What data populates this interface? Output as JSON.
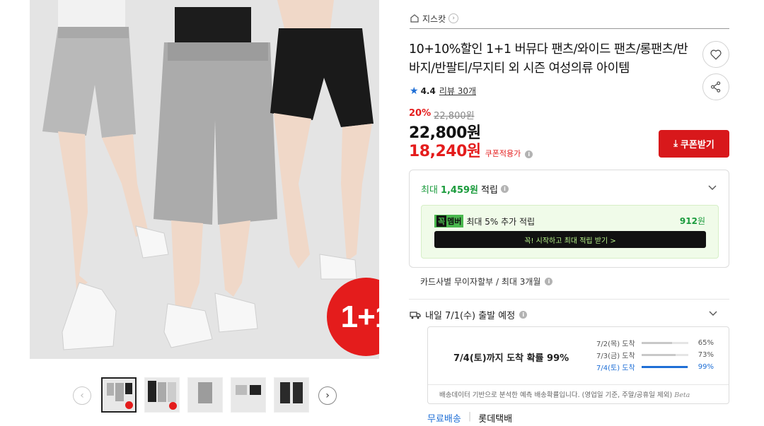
{
  "store": {
    "name": "지스캇"
  },
  "product": {
    "title": "10+10%할인 1+1 버뮤다 팬츠/와이드 팬츠/롱팬츠/반바지/반팔티/무지티 외 시즌 여성의류 아이템",
    "badge": "1+1",
    "rating": "4.4",
    "review_label": "리뷰 30개"
  },
  "price": {
    "discount_pct": "20%",
    "original": "22,800원",
    "price": "22,800원",
    "coupon_price": "18,240원",
    "coupon_label": "쿠폰적용가"
  },
  "buttons": {
    "coupon": "쿠폰받기"
  },
  "points": {
    "prefix": "최대",
    "amount": "1,459원",
    "suffix": "적립",
    "member_logo_k": "꼭",
    "member_logo": "멤버",
    "member_text": "최대 5% 추가 적립",
    "member_amount": "912",
    "member_unit": "원",
    "member_cta": "꼭! 시작하고 최대 적립 받기 >"
  },
  "installment": "카드사별 무이자할부 / 최대 3개월",
  "delivery": {
    "label": "내일 7/1(수) 출발 예정",
    "probability_headline": "7/4(토)까지 도착 확률 99%",
    "items": [
      {
        "date": "7/2(목) 도착",
        "pct": "65%",
        "value": 0.65
      },
      {
        "date": "7/3(금) 도착",
        "pct": "73%",
        "value": 0.73
      },
      {
        "date": "7/4(토) 도착",
        "pct": "99%",
        "value": 0.99
      }
    ],
    "note": "배송데이터 기반으로 분석한 예측 배송확률입니다. (영업일 기준, 주말/공휴일 제외)",
    "beta": "Beta"
  },
  "shipping": {
    "free": "무료배송",
    "carrier": "롯데택배"
  },
  "icons": {
    "store": "store-icon",
    "heart": "heart-icon",
    "share": "share-icon",
    "truck": "truck-icon",
    "star": "star-icon"
  },
  "colors": {
    "accent_red": "#d8181b",
    "point_green": "#1a9b3c",
    "link_blue": "#1f6fd6"
  }
}
